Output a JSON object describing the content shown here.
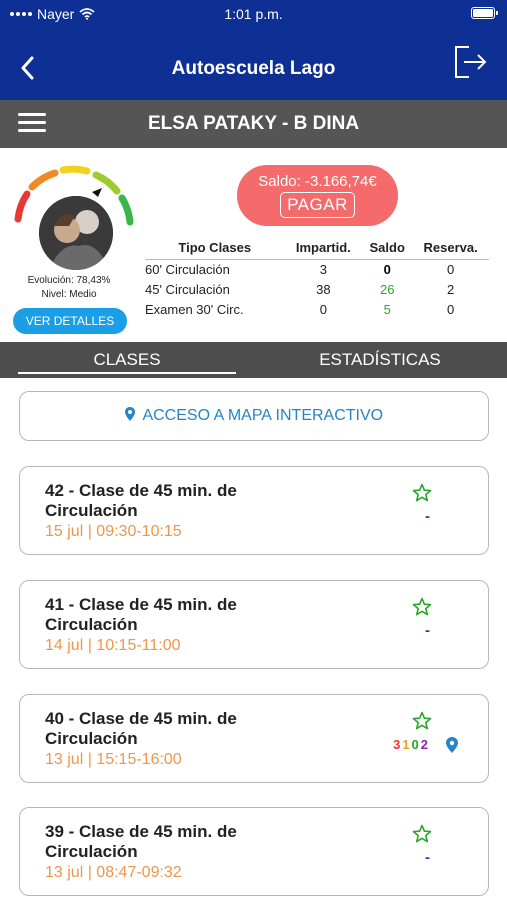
{
  "status": {
    "carrier": "Nayer",
    "time": "1:01 p.m."
  },
  "header": {
    "title": "Autoescuela Lago"
  },
  "user": {
    "name": "ELSA PATAKY - B DINA"
  },
  "profile": {
    "evolution": "Evolución: 78,43%",
    "level": "Nivel: Medio",
    "details_label": "VER DETALLES"
  },
  "balance": {
    "text": "Saldo: -3.166,74€",
    "pay_label": "PAGAR"
  },
  "classes_table": {
    "headers": [
      "Tipo Clases",
      "Impartid.",
      "Saldo",
      "Reserva."
    ],
    "rows": [
      [
        "60' Circulación",
        "3",
        "0",
        "0"
      ],
      [
        "45' Circulación",
        "38",
        "26",
        "2"
      ],
      [
        "Examen 30' Circ.",
        "0",
        "5",
        "0"
      ]
    ]
  },
  "tabs": [
    "CLASES",
    "ESTADÍSTICAS"
  ],
  "map_button": {
    "label": "ACCESO A MAPA INTERACTIVO"
  },
  "lessons": [
    {
      "title": "42 - Clase de 45 min. de Circulación",
      "date": "15 jul | 09:30-10:15",
      "mark": "-"
    },
    {
      "title": "41 - Clase de 45 min. de Circulación",
      "date": "14 jul | 10:15-11:00",
      "mark": "-"
    },
    {
      "title": "40 - Clase de 45 min. de Circulación",
      "date": "13 jul | 15:15-16:00",
      "digits": [
        "3",
        "1",
        "0",
        "2"
      ]
    },
    {
      "title": "39 - Clase de 45 min. de Circulación",
      "date": "13 jul | 08:47-09:32",
      "mark": "-"
    }
  ],
  "colors": {
    "header_bg": "#0e2f94",
    "userbar_bg": "#555555",
    "tabs_bg": "#4d4d4d",
    "accent_blue": "#1a9ee6",
    "balance_red": "#f56b6b",
    "date_orange": "#f0964a",
    "star_green": "#2aa52a",
    "digit_colors": [
      "#e53935",
      "#f0a020",
      "#2aa52a",
      "#8e24aa"
    ]
  }
}
